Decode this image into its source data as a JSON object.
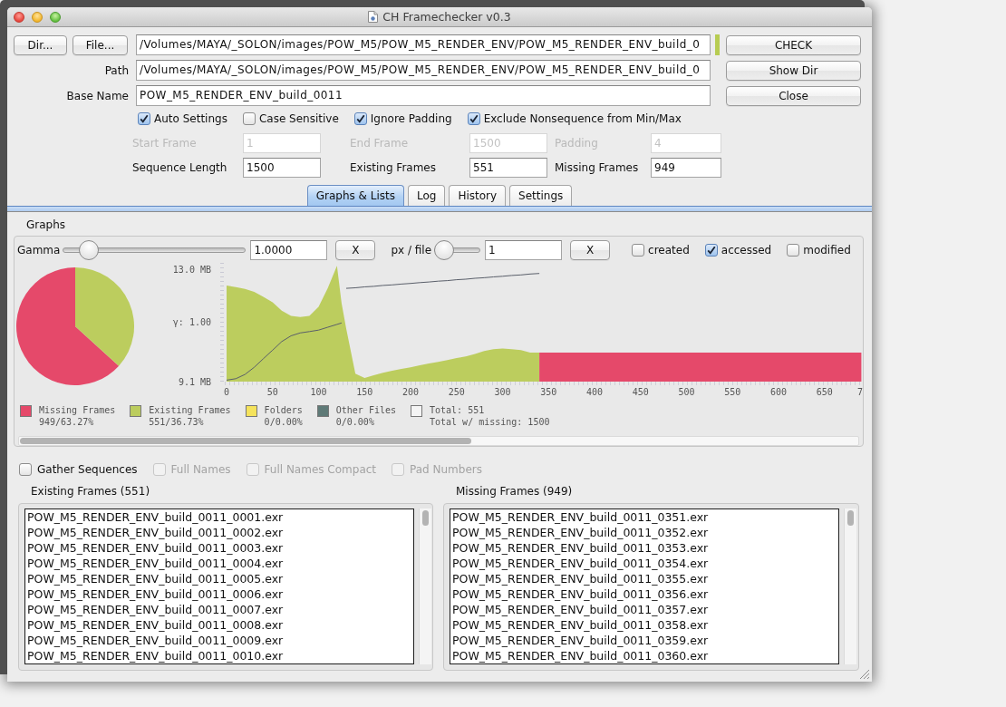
{
  "window": {
    "title": "CH Framechecker v0.3"
  },
  "source": {
    "buttons": [
      "Dir...",
      "File..."
    ],
    "value": "/Volumes/MAYA/_SOLON/images/POW_M5/POW_M5_RENDER_ENV/POW_M5_RENDER_ENV_build_0",
    "valid": true,
    "action": "CHECK"
  },
  "path": {
    "label": "Path",
    "value": "/Volumes/MAYA/_SOLON/images/POW_M5/POW_M5_RENDER_ENV/POW_M5_RENDER_ENV_build_0",
    "action": "Show Dir"
  },
  "base_name": {
    "label": "Base Name",
    "value": "POW_M5_RENDER_ENV_build_0011",
    "action": "Close"
  },
  "options": [
    {
      "label": "Auto Settings",
      "checked": true
    },
    {
      "label": "Case Sensitive",
      "checked": false
    },
    {
      "label": "Ignore Padding",
      "checked": true
    },
    {
      "label": "Exclude Nonsequence from Min/Max",
      "checked": true
    }
  ],
  "frame_settings": [
    {
      "label": "Start Frame",
      "value": "1",
      "disabled": true
    },
    {
      "label": "End Frame",
      "value": "1500",
      "disabled": true
    },
    {
      "label": "Padding",
      "value": "4",
      "disabled": true
    },
    {
      "label": "Sequence Length",
      "value": "1500",
      "disabled": false
    },
    {
      "label": "Existing Frames",
      "value": "551",
      "disabled": false
    },
    {
      "label": "Missing Frames",
      "value": "949",
      "disabled": false
    }
  ],
  "tabs": [
    {
      "label": "Graphs & Lists",
      "selected": true
    },
    {
      "label": "Log",
      "selected": false
    },
    {
      "label": "History",
      "selected": false
    },
    {
      "label": "Settings",
      "selected": false
    }
  ],
  "graphs": {
    "title": "Graphs",
    "controls": [
      {
        "label": "Gamma",
        "level": 0.1,
        "value": "1.0000",
        "reset": "X"
      },
      {
        "label": "px / file",
        "level": 0,
        "value": "1",
        "reset": "X"
      }
    ],
    "time_options": [
      {
        "label": "created",
        "checked": false
      },
      {
        "label": "accessed",
        "checked": true
      },
      {
        "label": "modified",
        "checked": false
      }
    ],
    "pie": {
      "chart_data": {
        "type": "pie",
        "values": [
          63.27,
          36.73
        ]
      }
    },
    "plot": {
      "gamma_label": "γ: 1.00",
      "edge_label": "7",
      "chart_data": {
        "type": "area",
        "x": [
          0,
          10,
          20,
          30,
          40,
          50,
          60,
          70,
          80,
          90,
          100,
          110,
          120,
          125,
          127,
          130,
          140,
          150,
          160,
          170,
          180,
          190,
          200,
          210,
          220,
          230,
          240,
          250,
          260,
          270,
          280,
          290,
          300,
          310,
          320,
          330,
          340,
          350,
          360,
          370,
          380,
          390,
          400,
          410,
          420,
          430,
          440,
          450,
          460,
          470,
          480,
          490,
          500,
          510,
          520,
          530,
          540,
          550,
          560,
          570,
          580,
          590,
          600,
          610,
          620,
          630,
          640,
          650,
          660,
          670,
          680,
          690
        ],
        "xlim": [
          0,
          691.6
        ],
        "ylim": [
          9.1,
          13.25
        ],
        "xticks": [
          0,
          50,
          100,
          150,
          200,
          250,
          300,
          350,
          400,
          450,
          500,
          550,
          600,
          650
        ],
        "yticks": [
          {
            "value": 9.1,
            "label": "9.1 MB"
          },
          {
            "value": 13.0,
            "label": "13.0 MB"
          }
        ],
        "series": [
          {
            "type": "area",
            "color": "#bccd5e",
            "values": [
              12.46,
              12.4,
              12.34,
              12.24,
              12.06,
              11.87,
              11.58,
              11.4,
              11.36,
              11.4,
              11.71,
              12.37,
              13.15,
              11.84,
              11.49,
              10.95,
              9.38,
              9.23,
              9.32,
              9.41,
              9.48,
              9.54,
              9.6,
              9.67,
              9.73,
              9.79,
              9.85,
              9.92,
              9.98,
              10.07,
              10.17,
              10.23,
              10.26,
              10.23,
              10.2,
              10.11,
              10.11,
              null,
              null,
              null,
              null,
              null,
              null,
              null,
              null,
              null,
              null,
              null,
              null,
              null,
              null,
              null,
              null,
              null,
              null,
              null,
              null,
              null,
              null,
              null,
              null,
              null,
              null,
              null,
              null,
              null,
              null,
              null,
              null,
              null,
              null,
              null
            ]
          },
          {
            "type": "area",
            "color": "#e5496a",
            "values": [
              null,
              null,
              null,
              null,
              null,
              null,
              null,
              null,
              null,
              null,
              null,
              null,
              null,
              null,
              null,
              null,
              null,
              null,
              null,
              null,
              null,
              null,
              null,
              null,
              null,
              null,
              null,
              null,
              null,
              null,
              null,
              null,
              null,
              null,
              null,
              null,
              10.11,
              10.11,
              10.11,
              10.11,
              10.11,
              10.11,
              10.11,
              10.11,
              10.11,
              10.11,
              10.11,
              10.11,
              10.11,
              10.11,
              10.11,
              10.11,
              10.11,
              10.11,
              10.11,
              10.11,
              10.11,
              10.11,
              10.11,
              10.11,
              10.11,
              10.11,
              10.11,
              10.11,
              10.11,
              10.11,
              10.11,
              10.11,
              10.11,
              10.11,
              10.11,
              10.11
            ]
          },
          {
            "type": "line",
            "color": "#5a5f6a",
            "values": [
              9.15,
              9.2,
              9.35,
              9.6,
              9.9,
              10.2,
              10.5,
              10.7,
              10.8,
              10.85,
              10.9,
              11.0,
              11.1,
              11.15,
              null,
              12.36,
              12.38,
              12.41,
              12.43,
              12.46,
              12.48,
              12.51,
              12.53,
              12.56,
              12.58,
              12.61,
              12.63,
              12.66,
              12.68,
              12.71,
              12.73,
              12.76,
              12.78,
              12.81,
              12.83,
              12.86,
              12.88,
              null,
              null,
              null,
              null,
              null,
              null,
              null,
              null,
              null,
              null,
              null,
              null,
              null,
              null,
              null,
              null,
              null,
              null,
              null,
              null,
              null,
              null,
              null,
              null,
              null,
              null,
              null,
              null,
              null,
              null,
              null,
              null,
              null,
              null,
              null
            ]
          }
        ]
      }
    },
    "legend": [
      {
        "label": "Missing Frames",
        "value": "949/63.27%",
        "color": "#e5496a"
      },
      {
        "label": "Existing Frames",
        "value": "551/36.73%",
        "color": "#bccd5e"
      },
      {
        "label": "Folders",
        "value": "0/0.00%",
        "color": "#f5e35c"
      },
      {
        "label": "Other Files",
        "value": "0/0.00%",
        "color": "#5f7a77"
      },
      {
        "label": "Total: 551",
        "value": "Total w/ missing: 1500",
        "color": "#f4f4f4"
      }
    ]
  },
  "list_options": [
    {
      "label": "Gather Sequences",
      "checked": false,
      "disabled": false
    },
    {
      "label": "Full Names",
      "checked": false,
      "disabled": true
    },
    {
      "label": "Full Names Compact",
      "checked": false,
      "disabled": true
    },
    {
      "label": "Pad Numbers",
      "checked": false,
      "disabled": true
    }
  ],
  "lists": [
    {
      "title": "Existing Frames (551)",
      "items": [
        "POW_M5_RENDER_ENV_build_0011_0001.exr",
        "POW_M5_RENDER_ENV_build_0011_0002.exr",
        "POW_M5_RENDER_ENV_build_0011_0003.exr",
        "POW_M5_RENDER_ENV_build_0011_0004.exr",
        "POW_M5_RENDER_ENV_build_0011_0005.exr",
        "POW_M5_RENDER_ENV_build_0011_0006.exr",
        "POW_M5_RENDER_ENV_build_0011_0007.exr",
        "POW_M5_RENDER_ENV_build_0011_0008.exr",
        "POW_M5_RENDER_ENV_build_0011_0009.exr",
        "POW_M5_RENDER_ENV_build_0011_0010.exr"
      ]
    },
    {
      "title": "Missing Frames (949)",
      "items": [
        "POW_M5_RENDER_ENV_build_0011_0351.exr",
        "POW_M5_RENDER_ENV_build_0011_0352.exr",
        "POW_M5_RENDER_ENV_build_0011_0353.exr",
        "POW_M5_RENDER_ENV_build_0011_0354.exr",
        "POW_M5_RENDER_ENV_build_0011_0355.exr",
        "POW_M5_RENDER_ENV_build_0011_0356.exr",
        "POW_M5_RENDER_ENV_build_0011_0357.exr",
        "POW_M5_RENDER_ENV_build_0011_0358.exr",
        "POW_M5_RENDER_ENV_build_0011_0359.exr",
        "POW_M5_RENDER_ENV_build_0011_0360.exr"
      ]
    }
  ]
}
